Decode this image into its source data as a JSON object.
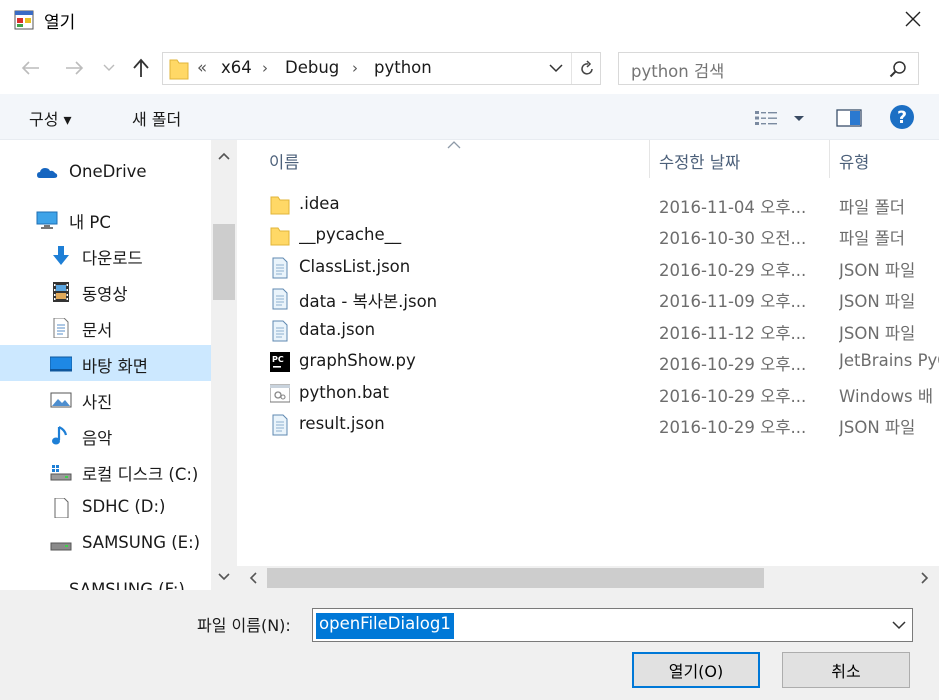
{
  "window": {
    "title": "열기",
    "app_icon": "dialog-app-icon",
    "close_icon": "close-icon"
  },
  "address": {
    "overflow": "«",
    "crumbs": [
      "x64",
      "Debug",
      "python"
    ],
    "separator": "›"
  },
  "search": {
    "placeholder": "python 검색"
  },
  "toolbar": {
    "organize_label": "구성 ▾",
    "new_folder_label": "새 폴더"
  },
  "nav": {
    "items": [
      {
        "label": "OneDrive",
        "icon": "onedrive-icon"
      },
      {
        "label": "내 PC",
        "icon": "pc-icon"
      },
      {
        "label": "다운로드",
        "icon": "download-icon"
      },
      {
        "label": "동영상",
        "icon": "video-icon"
      },
      {
        "label": "문서",
        "icon": "document-icon"
      },
      {
        "label": "바탕 화면",
        "icon": "desktop-icon",
        "selected": true
      },
      {
        "label": "사진",
        "icon": "pictures-icon"
      },
      {
        "label": "음악",
        "icon": "music-icon"
      },
      {
        "label": "로컬 디스크 (C:)",
        "icon": "local-disk-icon"
      },
      {
        "label": "SDHC (D:)",
        "icon": "sd-card-icon"
      },
      {
        "label": "SAMSUNG (E:)",
        "icon": "drive-icon"
      },
      {
        "label": "SAMSUNG (F:)",
        "icon": "drive-icon"
      }
    ]
  },
  "files": {
    "columns": [
      "이름",
      "수정한 날짜",
      "유형"
    ],
    "rows": [
      {
        "name": ".idea",
        "date": "2016-11-04 오후...",
        "type": "파일 폴더",
        "icon": "folder-icon"
      },
      {
        "name": "__pycache__",
        "date": "2016-10-30 오전...",
        "type": "파일 폴더",
        "icon": "folder-icon"
      },
      {
        "name": "ClassList.json",
        "date": "2016-10-29 오후...",
        "type": "JSON 파일",
        "icon": "text-file-icon"
      },
      {
        "name": "data - 복사본.json",
        "date": "2016-11-09 오후...",
        "type": "JSON 파일",
        "icon": "text-file-icon"
      },
      {
        "name": "data.json",
        "date": "2016-11-12 오후...",
        "type": "JSON 파일",
        "icon": "text-file-icon"
      },
      {
        "name": "graphShow.py",
        "date": "2016-10-29 오후...",
        "type": "JetBrains PyC",
        "icon": "pycharm-file-icon"
      },
      {
        "name": "python.bat",
        "date": "2016-10-29 오후...",
        "type": "Windows 배",
        "icon": "batch-file-icon"
      },
      {
        "name": "result.json",
        "date": "2016-10-29 오후...",
        "type": "JSON 파일",
        "icon": "text-file-icon"
      }
    ]
  },
  "footer": {
    "filename_label": "파일 이름(N):",
    "filename_value": "openFileDialog1",
    "open_label": "열기(O)",
    "cancel_label": "취소"
  },
  "colors": {
    "selection": "#cce8ff",
    "accent": "#0078d7",
    "help": "#1c6fc4"
  }
}
